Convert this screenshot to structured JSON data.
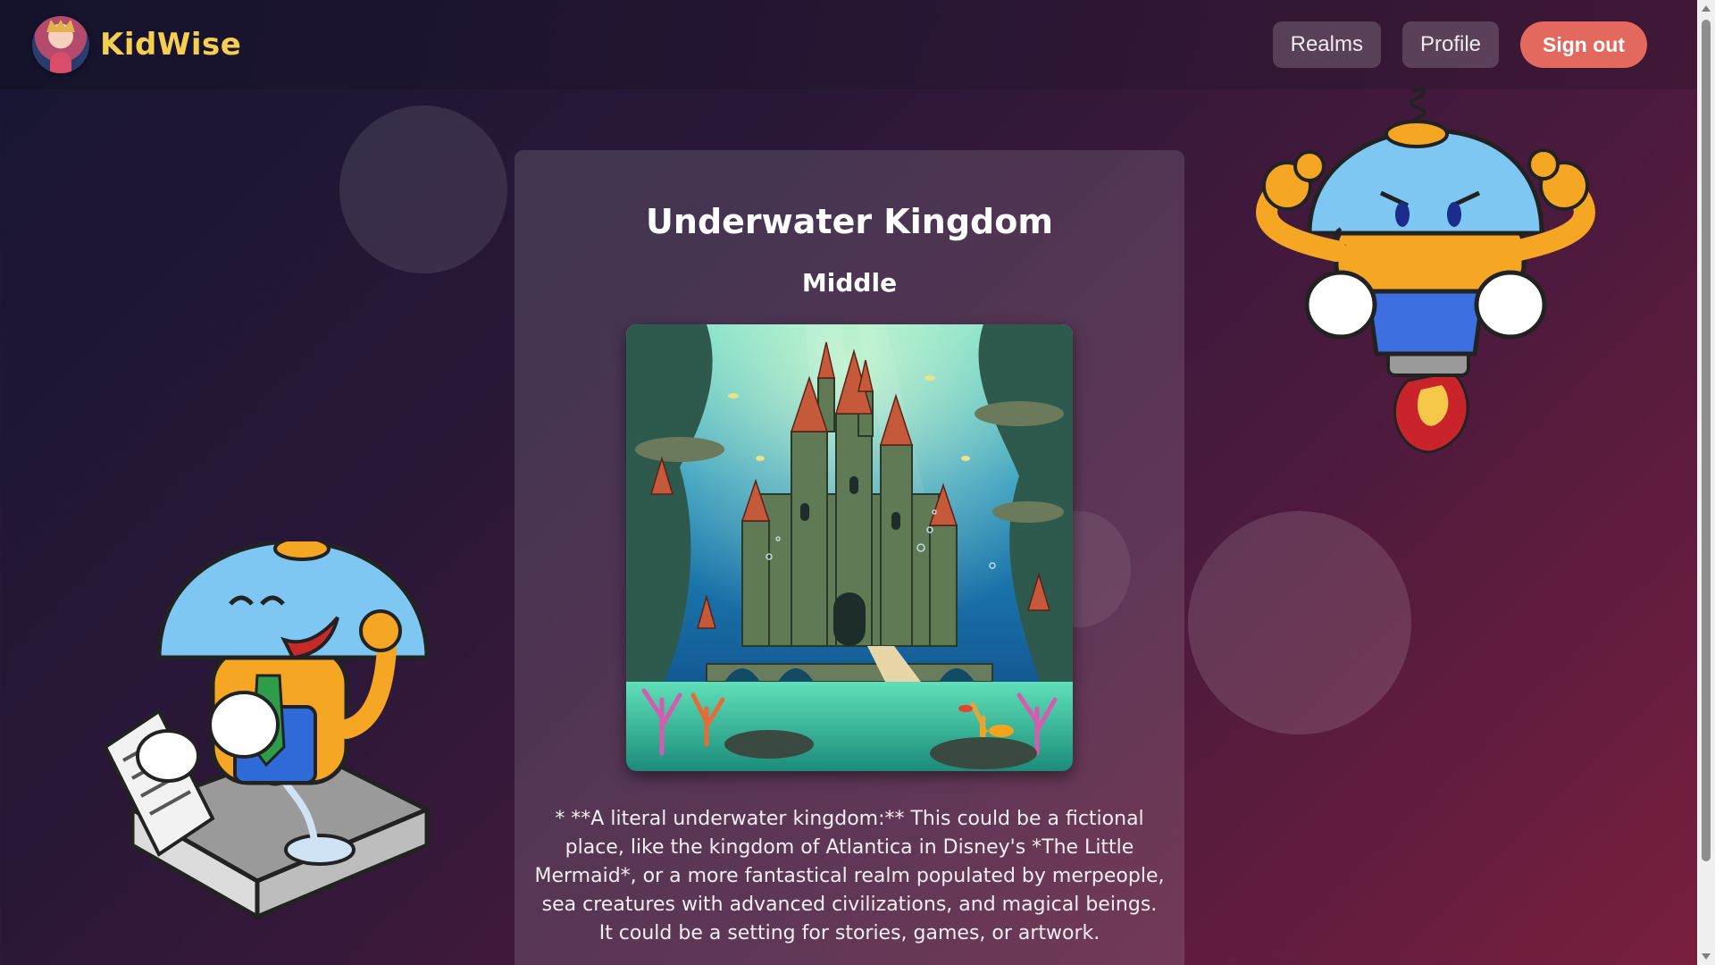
{
  "app": {
    "name": "KidWise",
    "logo_icon": "princess-avatar-icon",
    "brand_color": "#f5cf4d"
  },
  "nav": {
    "realms_label": "Realms",
    "profile_label": "Profile",
    "signout_label": "Sign out",
    "signout_color": "#e3685e"
  },
  "realm": {
    "title": "Underwater Kingdom",
    "level": "Middle",
    "image_alt_icon": "underwater-castle-illustration",
    "description": "* **A literal underwater kingdom:** This could be a fictional place, like the kingdom of Atlantica in Disney's *The Little Mermaid*, or a more fantastical realm populated by merpeople, sea creatures with advanced civilizations, and magical beings. It could be a setting for stories, games, or artwork."
  },
  "mascots": {
    "left": "reading-robot-mascot",
    "right": "rocket-robot-mascot"
  }
}
